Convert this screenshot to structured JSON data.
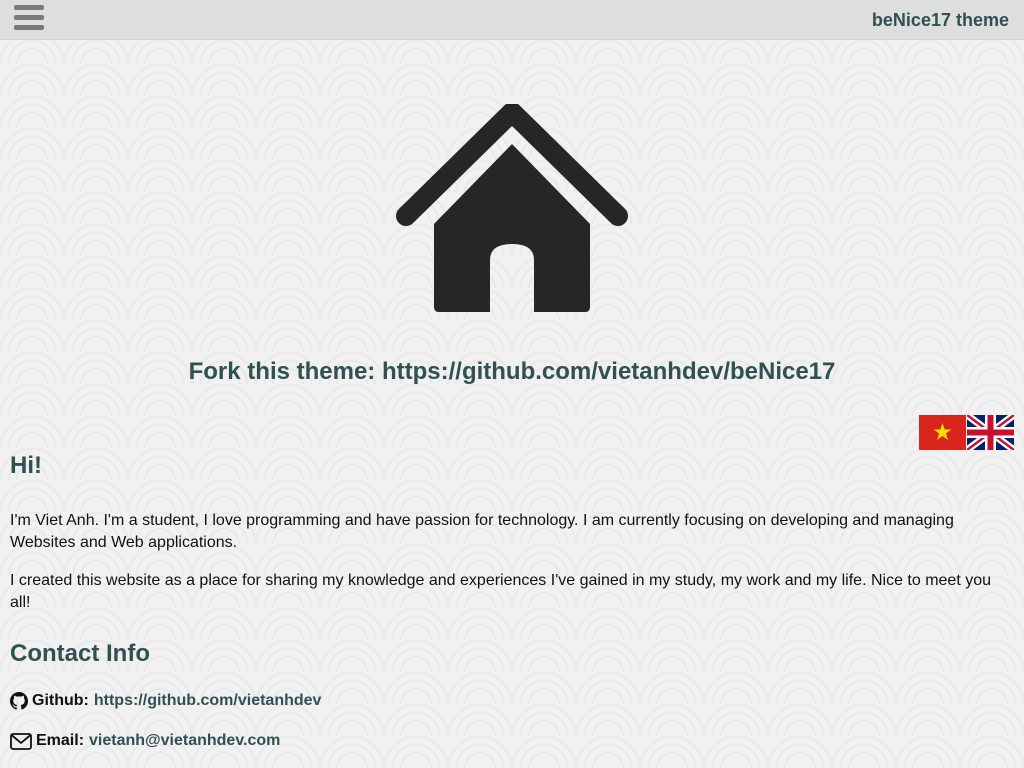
{
  "header": {
    "menu_icon": "hamburger-menu-icon",
    "site_title": "beNice17 theme"
  },
  "hero": {
    "icon": "home-icon",
    "fork_prefix": "Fork this theme: ",
    "fork_url": "https://github.com/vietanhdev/beNice17"
  },
  "languages": [
    {
      "name": "vietnam-flag-icon"
    },
    {
      "name": "uk-flag-icon"
    }
  ],
  "about": {
    "heading": "Hi!",
    "para1": "I'm Viet Anh. I'm a student, I love programming and have passion for technology. I am currently focusing on developing and managing Websites and Web applications.",
    "para2": "I created this website as a place for sharing my knowledge and experiences I've gained in my study, my work and my life. Nice to meet you all!"
  },
  "contact": {
    "heading": "Contact Info",
    "github_label": "Github:",
    "github_url": "https://github.com/vietanhdev",
    "email_label": "Email:",
    "email": "vietanh@vietanhdev.com"
  },
  "colors": {
    "accent": "#2f5150",
    "topbar": "#dedede",
    "icon": "#262626"
  }
}
